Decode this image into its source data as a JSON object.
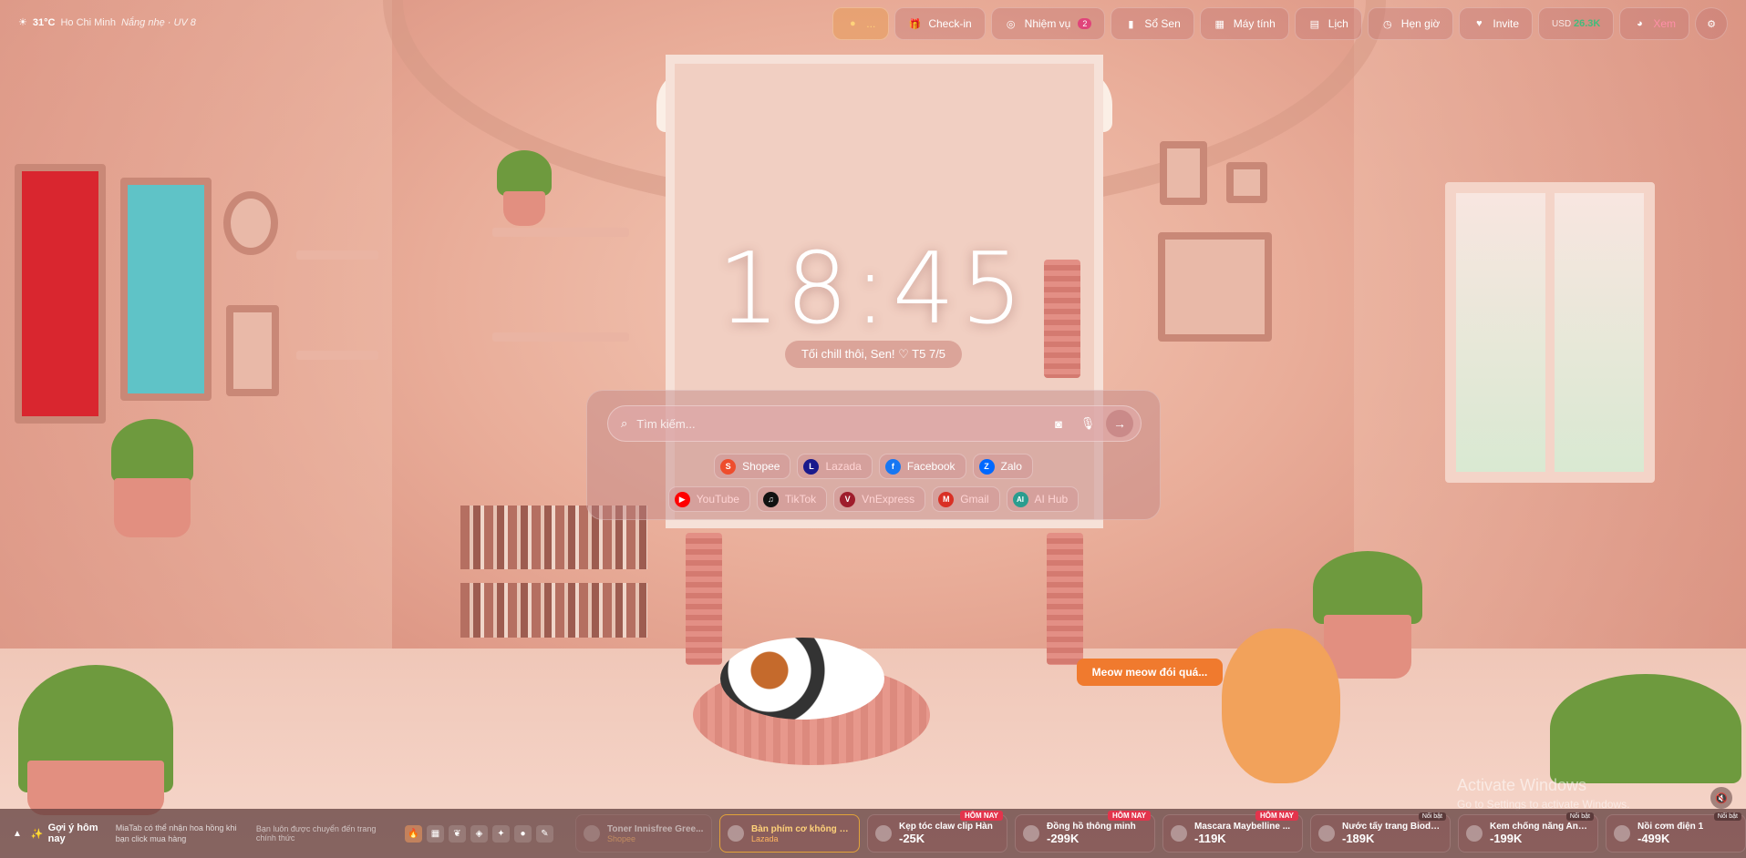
{
  "weather": {
    "temp": "31°C",
    "city": "Ho Chi Minh",
    "condition": "Nắng nhẹ · UV 8"
  },
  "topbar": {
    "coins": "...",
    "checkin": "Check-in",
    "missions": "Nhiệm vụ",
    "missions_badge": "2",
    "notebook": "Sổ Sen",
    "calculator": "Máy tính",
    "calendar": "Lịch",
    "timer": "Hẹn giờ",
    "invite": "Invite",
    "usd_label": "USD",
    "usd_value": "26.3K",
    "view": "Xem"
  },
  "clock": {
    "time": "18:45",
    "greeting": "Tối chill thôi, Sen! ♡ T5 7/5"
  },
  "search": {
    "placeholder": "Tìm kiếm...",
    "go": "→"
  },
  "shortcuts_row1": [
    {
      "label": "Shopee",
      "letter": "S",
      "color": "#ee4d2d"
    },
    {
      "label": "Lazada",
      "letter": "L",
      "color": "#1a1a8c"
    },
    {
      "label": "Facebook",
      "letter": "f",
      "color": "#1877f2"
    },
    {
      "label": "Zalo",
      "letter": "Z",
      "color": "#0068ff"
    }
  ],
  "shortcuts_row2": [
    {
      "label": "YouTube",
      "letter": "▶",
      "color": "#ff0000"
    },
    {
      "label": "TikTok",
      "letter": "♫",
      "color": "#111111"
    },
    {
      "label": "VnExpress",
      "letter": "V",
      "color": "#9f1d2c"
    },
    {
      "label": "Gmail",
      "letter": "M",
      "color": "#d93025"
    },
    {
      "label": "AI Hub",
      "letter": "AI",
      "color": "#2a9d8f"
    }
  ],
  "bubble": "Meow meow đói quá...",
  "activate": {
    "title": "Activate Windows",
    "sub": "Go to Settings to activate Windows."
  },
  "bottombar": {
    "title": "Gợi ý hôm nay",
    "hint": "MiaTab có thể nhận hoa hồng khi bạn click mua hàng",
    "hint2": "Bạn luôn được chuyển đến trang chính thức",
    "cards": [
      {
        "name": "Toner Innisfree Gree...",
        "price": "",
        "old": "",
        "src": "Shopee",
        "tag": ""
      },
      {
        "name": "Bàn phím cơ không d...",
        "price": "",
        "old": "",
        "src": "Lazada",
        "tag": ""
      },
      {
        "name": "Kẹp tóc claw clip Hàn",
        "price": "-25K",
        "old": "",
        "src": "",
        "tag": "HÔM NAY"
      },
      {
        "name": "Đồng hồ thông minh",
        "price": "-299K",
        "old": "",
        "src": "",
        "tag": "HÔM NAY"
      },
      {
        "name": "Mascara Maybelline ...",
        "price": "-119K",
        "old": "",
        "src": "",
        "tag": "HÔM NAY"
      },
      {
        "name": "Nước tẩy trang Biode...",
        "price": "-189K",
        "old": "",
        "src": "",
        "tag": "Nổi bật"
      },
      {
        "name": "Kem chống nắng Ane...",
        "price": "-199K",
        "old": "",
        "src": "",
        "tag": "Nổi bật"
      },
      {
        "name": "Nồi cơm điện 1",
        "price": "-499K",
        "old": "",
        "src": "",
        "tag": "Nổi bật"
      }
    ]
  }
}
